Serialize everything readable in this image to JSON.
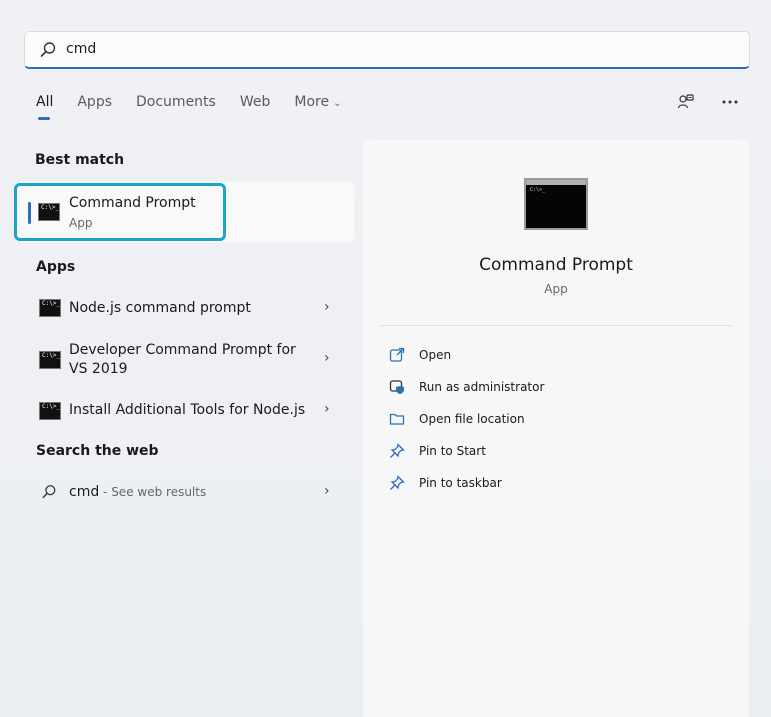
{
  "search": {
    "query": "cmd"
  },
  "tabs": [
    {
      "label": "All",
      "active": true
    },
    {
      "label": "Apps"
    },
    {
      "label": "Documents"
    },
    {
      "label": "Web"
    },
    {
      "label": "More"
    }
  ],
  "icons": {
    "search": "search-icon",
    "share": "share-icon",
    "more": "more-icon",
    "chevron": "chevron-right-icon",
    "cmd": "cmd-app-icon"
  },
  "cmd_icon_text": "C:\\>_",
  "sections": {
    "best_match": "Best match",
    "apps": "Apps",
    "search_web": "Search the web"
  },
  "best_match": {
    "title": "Command Prompt",
    "subtitle": "App"
  },
  "apps": [
    {
      "title_line1": "Node.js command prompt"
    },
    {
      "title_line1": "Developer Command Prompt for",
      "title_line2": "VS 2019"
    },
    {
      "title_line1": "Install Additional Tools for Node.js"
    }
  ],
  "web": {
    "query": "cmd",
    "suffix": " - See web results"
  },
  "panel": {
    "title": "Command Prompt",
    "subtitle": "App",
    "actions": [
      {
        "label": "Open",
        "icon": "open-icon"
      },
      {
        "label": "Run as administrator",
        "icon": "shield-icon"
      },
      {
        "label": "Open file location",
        "icon": "folder-icon"
      },
      {
        "label": "Pin to Start",
        "icon": "pin-icon"
      },
      {
        "label": "Pin to taskbar",
        "icon": "pin-icon"
      }
    ]
  },
  "colors": {
    "accent": "#2f6fb8",
    "highlight": "#19a4c8"
  }
}
